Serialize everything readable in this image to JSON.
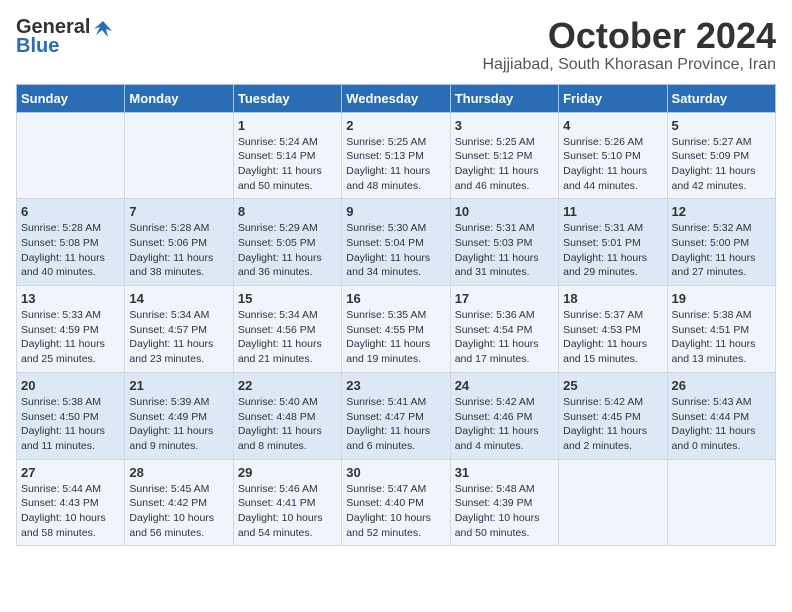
{
  "header": {
    "logo_general": "General",
    "logo_blue": "Blue",
    "month_title": "October 2024",
    "location": "Hajjiabad, South Khorasan Province, Iran"
  },
  "days_of_week": [
    "Sunday",
    "Monday",
    "Tuesday",
    "Wednesday",
    "Thursday",
    "Friday",
    "Saturday"
  ],
  "weeks": [
    [
      {
        "day": "",
        "content": ""
      },
      {
        "day": "",
        "content": ""
      },
      {
        "day": "1",
        "content": "Sunrise: 5:24 AM\nSunset: 5:14 PM\nDaylight: 11 hours and 50 minutes."
      },
      {
        "day": "2",
        "content": "Sunrise: 5:25 AM\nSunset: 5:13 PM\nDaylight: 11 hours and 48 minutes."
      },
      {
        "day": "3",
        "content": "Sunrise: 5:25 AM\nSunset: 5:12 PM\nDaylight: 11 hours and 46 minutes."
      },
      {
        "day": "4",
        "content": "Sunrise: 5:26 AM\nSunset: 5:10 PM\nDaylight: 11 hours and 44 minutes."
      },
      {
        "day": "5",
        "content": "Sunrise: 5:27 AM\nSunset: 5:09 PM\nDaylight: 11 hours and 42 minutes."
      }
    ],
    [
      {
        "day": "6",
        "content": "Sunrise: 5:28 AM\nSunset: 5:08 PM\nDaylight: 11 hours and 40 minutes."
      },
      {
        "day": "7",
        "content": "Sunrise: 5:28 AM\nSunset: 5:06 PM\nDaylight: 11 hours and 38 minutes."
      },
      {
        "day": "8",
        "content": "Sunrise: 5:29 AM\nSunset: 5:05 PM\nDaylight: 11 hours and 36 minutes."
      },
      {
        "day": "9",
        "content": "Sunrise: 5:30 AM\nSunset: 5:04 PM\nDaylight: 11 hours and 34 minutes."
      },
      {
        "day": "10",
        "content": "Sunrise: 5:31 AM\nSunset: 5:03 PM\nDaylight: 11 hours and 31 minutes."
      },
      {
        "day": "11",
        "content": "Sunrise: 5:31 AM\nSunset: 5:01 PM\nDaylight: 11 hours and 29 minutes."
      },
      {
        "day": "12",
        "content": "Sunrise: 5:32 AM\nSunset: 5:00 PM\nDaylight: 11 hours and 27 minutes."
      }
    ],
    [
      {
        "day": "13",
        "content": "Sunrise: 5:33 AM\nSunset: 4:59 PM\nDaylight: 11 hours and 25 minutes."
      },
      {
        "day": "14",
        "content": "Sunrise: 5:34 AM\nSunset: 4:57 PM\nDaylight: 11 hours and 23 minutes."
      },
      {
        "day": "15",
        "content": "Sunrise: 5:34 AM\nSunset: 4:56 PM\nDaylight: 11 hours and 21 minutes."
      },
      {
        "day": "16",
        "content": "Sunrise: 5:35 AM\nSunset: 4:55 PM\nDaylight: 11 hours and 19 minutes."
      },
      {
        "day": "17",
        "content": "Sunrise: 5:36 AM\nSunset: 4:54 PM\nDaylight: 11 hours and 17 minutes."
      },
      {
        "day": "18",
        "content": "Sunrise: 5:37 AM\nSunset: 4:53 PM\nDaylight: 11 hours and 15 minutes."
      },
      {
        "day": "19",
        "content": "Sunrise: 5:38 AM\nSunset: 4:51 PM\nDaylight: 11 hours and 13 minutes."
      }
    ],
    [
      {
        "day": "20",
        "content": "Sunrise: 5:38 AM\nSunset: 4:50 PM\nDaylight: 11 hours and 11 minutes."
      },
      {
        "day": "21",
        "content": "Sunrise: 5:39 AM\nSunset: 4:49 PM\nDaylight: 11 hours and 9 minutes."
      },
      {
        "day": "22",
        "content": "Sunrise: 5:40 AM\nSunset: 4:48 PM\nDaylight: 11 hours and 8 minutes."
      },
      {
        "day": "23",
        "content": "Sunrise: 5:41 AM\nSunset: 4:47 PM\nDaylight: 11 hours and 6 minutes."
      },
      {
        "day": "24",
        "content": "Sunrise: 5:42 AM\nSunset: 4:46 PM\nDaylight: 11 hours and 4 minutes."
      },
      {
        "day": "25",
        "content": "Sunrise: 5:42 AM\nSunset: 4:45 PM\nDaylight: 11 hours and 2 minutes."
      },
      {
        "day": "26",
        "content": "Sunrise: 5:43 AM\nSunset: 4:44 PM\nDaylight: 11 hours and 0 minutes."
      }
    ],
    [
      {
        "day": "27",
        "content": "Sunrise: 5:44 AM\nSunset: 4:43 PM\nDaylight: 10 hours and 58 minutes."
      },
      {
        "day": "28",
        "content": "Sunrise: 5:45 AM\nSunset: 4:42 PM\nDaylight: 10 hours and 56 minutes."
      },
      {
        "day": "29",
        "content": "Sunrise: 5:46 AM\nSunset: 4:41 PM\nDaylight: 10 hours and 54 minutes."
      },
      {
        "day": "30",
        "content": "Sunrise: 5:47 AM\nSunset: 4:40 PM\nDaylight: 10 hours and 52 minutes."
      },
      {
        "day": "31",
        "content": "Sunrise: 5:48 AM\nSunset: 4:39 PM\nDaylight: 10 hours and 50 minutes."
      },
      {
        "day": "",
        "content": ""
      },
      {
        "day": "",
        "content": ""
      }
    ]
  ]
}
